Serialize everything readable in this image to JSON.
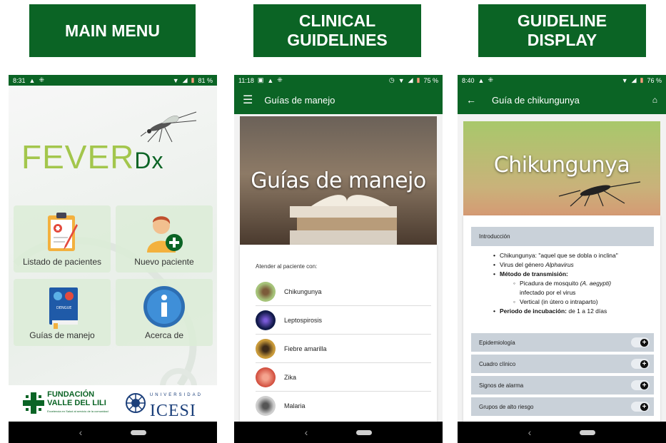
{
  "labels": {
    "main_menu": "MAIN MENU",
    "clinical_guidelines_line1": "CLINICAL",
    "clinical_guidelines_line2": "GUIDELINES",
    "guideline_display_line1": "GUIDELINE",
    "guideline_display_line2": "DISPLAY"
  },
  "colors": {
    "brand_green": "#0b6425",
    "logo_light_green": "#a3c64c",
    "accordion_gray": "#c9d1d9"
  },
  "phone1": {
    "status": {
      "time": "8:31",
      "battery": "81 %"
    },
    "logo_fever": "FEVER",
    "logo_dx": "Dx",
    "tiles": [
      {
        "label": "Listado de pacientes",
        "icon": "clipboard-icon"
      },
      {
        "label": "Nuevo paciente",
        "icon": "add-person-icon"
      },
      {
        "label": "Guías de manejo",
        "icon": "guide-book-icon"
      },
      {
        "label": "Acerca de",
        "icon": "info-icon"
      }
    ],
    "book_label": "DENGUE",
    "footer": {
      "fvl_line1": "FUNDACIÓN",
      "fvl_line2": "VALLE DEL LILI",
      "fvl_tagline": "Excelencia en Salud al servicio de la comunidad",
      "icesi_top": "UNIVERSIDAD",
      "icesi_name": "ICESI"
    }
  },
  "phone2": {
    "status": {
      "time": "11:18",
      "battery": "75 %"
    },
    "appbar_title": "Guías de manejo",
    "hero_title": "Guías de manejo",
    "attend_label": "Atender al paciente con:",
    "diseases": [
      "Chikungunya",
      "Leptospirosis",
      "Fiebre amarilla",
      "Zika",
      "Malaria"
    ]
  },
  "phone3": {
    "status": {
      "time": "8:40",
      "battery": "76 %"
    },
    "appbar_title": "Guía de chikungunya",
    "hero_title": "Chikungunya",
    "intro_label": "Introducción",
    "bullets": {
      "b1": "Chikungunya: \"aquel que se dobla o inclina\"",
      "b2_prefix": "Virus del género ",
      "b2_italic": "Alphavirus",
      "b3": "Método de transmisión:",
      "s1_prefix": "Picadura de mosquito ",
      "s1_italic": "(A. aegypti)",
      "s1_cont": "infectado por el virus",
      "s2": "Vertical (in útero o intraparto)",
      "b4_bold": "Periodo de incubación:",
      "b4_rest": " de 1 a 12 días"
    },
    "accordion": [
      "Epidemiología",
      "Cuadro clínico",
      "Signos de alarma",
      "Grupos de alto riesgo"
    ]
  }
}
